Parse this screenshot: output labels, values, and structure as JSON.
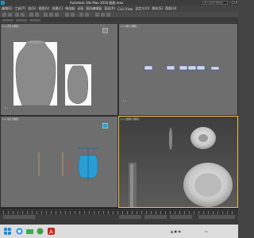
{
  "window": {
    "title": "Autodesk 3ds Max 2016    瓶瓶.max",
    "search_placeholder": "键入关键字或短语",
    "minimize": "–",
    "maximize": "□",
    "close": "×"
  },
  "menubar": {
    "items": [
      "编辑(E)",
      "工具(T)",
      "组(G)",
      "视图(V)",
      "创建(C)",
      "修改器",
      "动画",
      "图形编辑器",
      "渲染(R)",
      "Civil View",
      "自定义(U)",
      "脚本(S)",
      "帮助(H)"
    ]
  },
  "viewports": {
    "top_left": {
      "label": "[+] [顶] [线框]"
    },
    "top_right": {
      "label": "[+] [前] [线框]"
    },
    "bottom_left": {
      "label": "[+] [左] [线框]"
    },
    "bottom_right": {
      "label": "[+] [透视] [真实]"
    }
  },
  "colors": {
    "accent_active_viewport": "#f0c040",
    "selection_cyan": "#2a9fd6",
    "autodesk_red": "#d02020"
  },
  "icons": [
    "search-icon",
    "view-cube-icon",
    "axis-tripod-icon",
    "start-icon",
    "browser-icon",
    "folder-icon",
    "wechat-icon",
    "autodesk-icon"
  ]
}
